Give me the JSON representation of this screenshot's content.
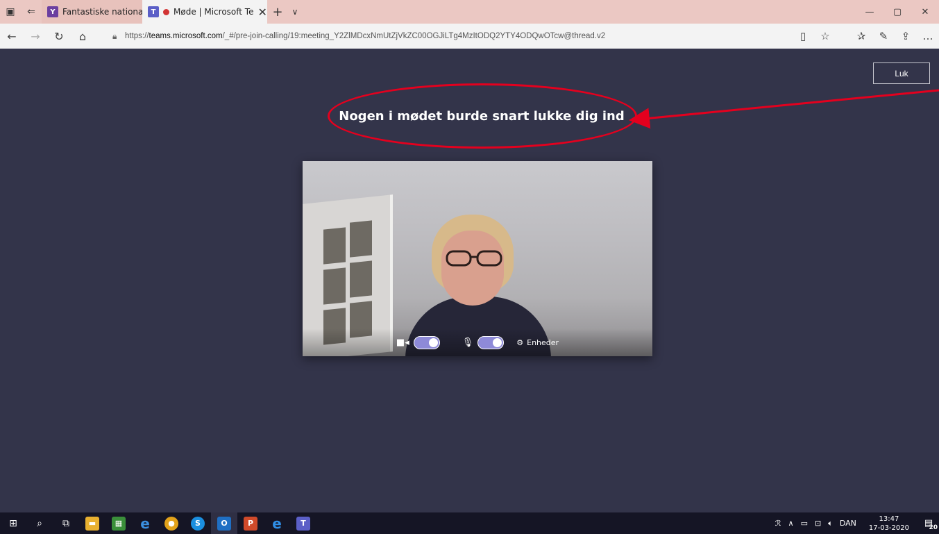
{
  "browser": {
    "tabs": [
      {
        "label": "Fantastiske nationalparker f",
        "icon": "yammer-icon",
        "active": false
      },
      {
        "label": "Møde | Microsoft Te",
        "icon": "teams-icon",
        "active": true
      }
    ],
    "url_prefix": "https://",
    "url_host": "teams.microsoft.com",
    "url_path": "/_#/pre-join-calling/19:meeting_Y2ZlMDcxNmUtZjVkZC00OGJiLTg4MzItODQ2YTY4ODQwOTcw@thread.v2"
  },
  "meeting": {
    "close_label": "Luk",
    "status_text": "Nogen i mødet burde snart lukke dig ind",
    "devices_label": "Enheder",
    "camera_on": true,
    "mic_on": true
  },
  "taskbar": {
    "language": "DAN",
    "time": "13:47",
    "date": "17-03-2020",
    "notification_count": "20"
  },
  "colors": {
    "teams_bg": "#33344a",
    "tab_strip": "#ebc8c3",
    "annotation_red": "#e4001e",
    "toggle_purple": "#8e8ad8"
  }
}
